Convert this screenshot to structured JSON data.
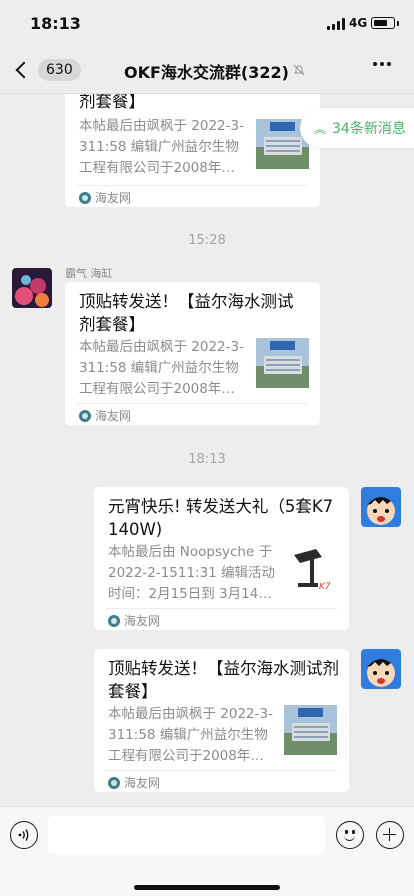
{
  "status_bar": {
    "time": "18:13",
    "network": "4G",
    "battery_level": 0.75
  },
  "nav": {
    "back_count": "630",
    "title": "OKF海水交流群(322)",
    "mute_icon": "mute-bell-icon",
    "more_icon": "more-icon"
  },
  "new_messages": "34条新消息",
  "messages": [
    {
      "kind": "card",
      "title": "剂套餐】",
      "desc": "本帖最后由飒枫于 2022-3-311:58 编辑广州益尔生物工程有限公司于2008年…",
      "source": "海友网",
      "thumb": "building-thumbnail"
    },
    {
      "kind": "timestamp",
      "text": "15:28"
    },
    {
      "kind": "card",
      "sender": "霸气 海缸",
      "title": "顶贴转发送！【益尔海水测试剂套餐】",
      "desc": "本帖最后由飒枫于 2022-3-311:58 编辑广州益尔生物工程有限公司于2008年…",
      "source": "海友网",
      "thumb": "building-thumbnail"
    },
    {
      "kind": "timestamp",
      "text": "18:13"
    },
    {
      "kind": "card",
      "title": "元宵快乐! 转发送大礼（5套K7 140W)",
      "desc": "本帖最后由 Noopsyche 于 2022-2-1511:31 编辑活动时间：2月15日到 3月14…",
      "source": "海友网",
      "thumb": "lamp-thumbnail"
    },
    {
      "kind": "card",
      "title": "顶贴转发送！【益尔海水测试剂套餐】",
      "desc": "本帖最后由飒枫于 2022-3-311:58 编辑广州益尔生物工程有限公司于2008年…",
      "source": "海友网",
      "thumb": "building-thumbnail"
    }
  ],
  "input_bar": {
    "placeholder": "",
    "voice_icon": "voice-icon",
    "emoji_icon": "emoji-icon",
    "add_icon": "add-icon"
  },
  "colors": {
    "background": "#ededed",
    "card": "#ffffff",
    "accent_green": "#4cb16a",
    "meta_gray": "#8c8c8c"
  }
}
